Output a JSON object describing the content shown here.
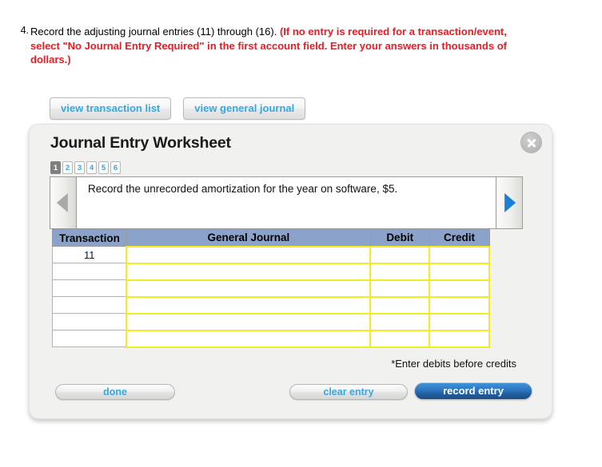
{
  "question": {
    "number": "4.",
    "text_plain": "Record the adjusting journal entries (11) through (16). ",
    "text_red": "(If no entry is required for a transaction/event, select \"No Journal Entry Required\" in the first account field. Enter your answers in thousands of dollars.)"
  },
  "view_buttons": [
    {
      "label": "view transaction list",
      "name": "view-transaction-list-button"
    },
    {
      "label": "view general journal",
      "name": "view-general-journal-button"
    }
  ],
  "panel": {
    "title": "Journal Entry Worksheet",
    "close_icon": "close-x-icon",
    "steps": [
      {
        "label": "1",
        "active": true
      },
      {
        "label": "2",
        "active": false
      },
      {
        "label": "3",
        "active": false
      },
      {
        "label": "4",
        "active": false
      },
      {
        "label": "5",
        "active": false
      },
      {
        "label": "6",
        "active": false
      }
    ],
    "nav": {
      "prev_icon": "triangle-left-icon",
      "next_icon": "triangle-right-icon",
      "prev_enabled": false,
      "next_enabled": true
    },
    "instruction": "Record the unrecorded amortization for the year on software, $5.",
    "table": {
      "headers": [
        "Transaction",
        "General Journal",
        "Debit",
        "Credit"
      ],
      "rows": [
        {
          "transaction": "11",
          "general_journal": "",
          "debit": "",
          "credit": ""
        },
        {
          "transaction": "",
          "general_journal": "",
          "debit": "",
          "credit": ""
        },
        {
          "transaction": "",
          "general_journal": "",
          "debit": "",
          "credit": ""
        },
        {
          "transaction": "",
          "general_journal": "",
          "debit": "",
          "credit": ""
        },
        {
          "transaction": "",
          "general_journal": "",
          "debit": "",
          "credit": ""
        },
        {
          "transaction": "",
          "general_journal": "",
          "debit": "",
          "credit": ""
        }
      ]
    },
    "footnote": "*Enter debits before credits",
    "actions": {
      "done": "done",
      "clear": "clear entry",
      "record": "record entry"
    }
  },
  "colors": {
    "accent_blue": "#35a8e0",
    "record_blue": "#2d74bd",
    "table_header": "#8ba3cb",
    "input_border": "#f2ed21",
    "alert_red": "#ed1c24",
    "panel_bg": "#f1f1f0"
  }
}
